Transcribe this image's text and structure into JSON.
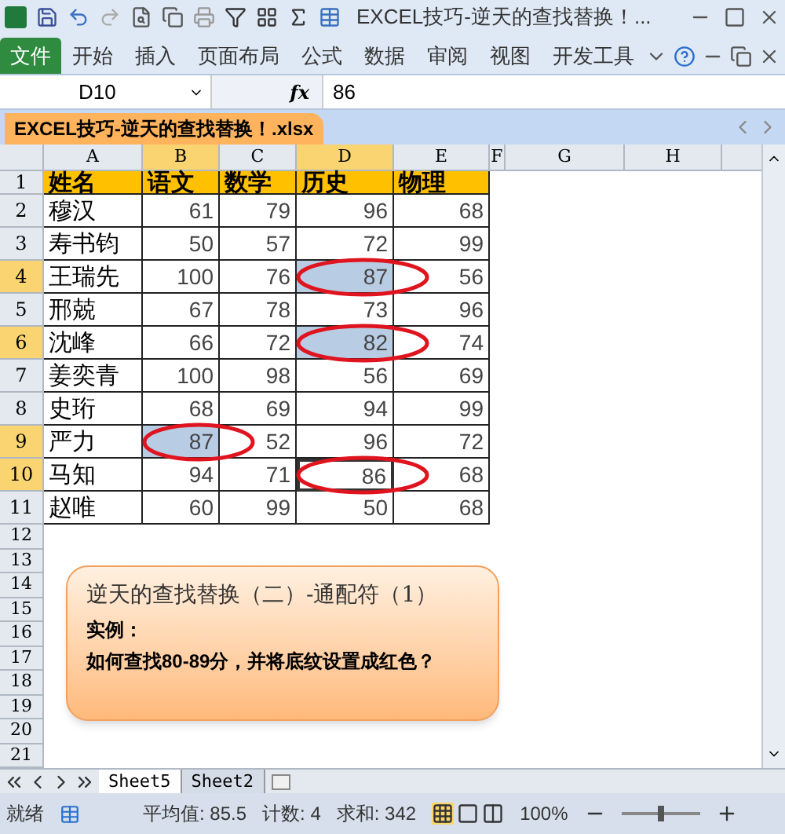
{
  "window": {
    "title": "EXCEL技巧-逆天的查找替换！..."
  },
  "ribbon_tabs": [
    {
      "label": "文件",
      "kind": "file"
    },
    {
      "label": "开始",
      "kind": "tab"
    },
    {
      "label": "插入",
      "kind": "tab"
    },
    {
      "label": "页面布局",
      "kind": "tab"
    },
    {
      "label": "公式",
      "kind": "tab"
    },
    {
      "label": "数据",
      "kind": "tab"
    },
    {
      "label": "审阅",
      "kind": "tab"
    },
    {
      "label": "视图",
      "kind": "tab"
    },
    {
      "label": "开发工具",
      "kind": "tab"
    }
  ],
  "formula_bar": {
    "name_box": "D10",
    "fx": "fx",
    "value": "86"
  },
  "document_tab": {
    "title": "EXCEL技巧-逆天的查找替换！.xlsx"
  },
  "columns": [
    {
      "label": "A",
      "selected": false
    },
    {
      "label": "B",
      "selected": true
    },
    {
      "label": "C",
      "selected": false
    },
    {
      "label": "D",
      "selected": true
    },
    {
      "label": "E",
      "selected": false
    },
    {
      "label": "F",
      "selected": false
    },
    {
      "label": "G",
      "selected": false
    },
    {
      "label": "H",
      "selected": false
    }
  ],
  "rows": [
    {
      "number": "1",
      "selected": false,
      "header": true,
      "cells": [
        {
          "value": "姓名",
          "selected": false,
          "active": false,
          "circled": false
        },
        {
          "value": "语文",
          "selected": false,
          "active": false,
          "circled": false
        },
        {
          "value": "数学",
          "selected": false,
          "active": false,
          "circled": false
        },
        {
          "value": "历史",
          "selected": false,
          "active": false,
          "circled": false
        },
        {
          "value": "物理",
          "selected": false,
          "active": false,
          "circled": false
        }
      ]
    },
    {
      "number": "2",
      "selected": false,
      "header": false,
      "cells": [
        {
          "value": "穆汉",
          "selected": false,
          "active": false,
          "circled": false
        },
        {
          "value": "61",
          "selected": false,
          "active": false,
          "circled": false
        },
        {
          "value": "79",
          "selected": false,
          "active": false,
          "circled": false
        },
        {
          "value": "96",
          "selected": false,
          "active": false,
          "circled": false
        },
        {
          "value": "68",
          "selected": false,
          "active": false,
          "circled": false
        }
      ]
    },
    {
      "number": "3",
      "selected": false,
      "header": false,
      "cells": [
        {
          "value": "寿书钧",
          "selected": false,
          "active": false,
          "circled": false
        },
        {
          "value": "50",
          "selected": false,
          "active": false,
          "circled": false
        },
        {
          "value": "57",
          "selected": false,
          "active": false,
          "circled": false
        },
        {
          "value": "72",
          "selected": false,
          "active": false,
          "circled": false
        },
        {
          "value": "99",
          "selected": false,
          "active": false,
          "circled": false
        }
      ]
    },
    {
      "number": "4",
      "selected": true,
      "header": false,
      "cells": [
        {
          "value": "王瑞先",
          "selected": false,
          "active": false,
          "circled": false
        },
        {
          "value": "100",
          "selected": false,
          "active": false,
          "circled": false
        },
        {
          "value": "76",
          "selected": false,
          "active": false,
          "circled": false
        },
        {
          "value": "87",
          "selected": true,
          "active": false,
          "circled": true
        },
        {
          "value": "56",
          "selected": false,
          "active": false,
          "circled": false
        }
      ]
    },
    {
      "number": "5",
      "selected": false,
      "header": false,
      "cells": [
        {
          "value": "邢兢",
          "selected": false,
          "active": false,
          "circled": false
        },
        {
          "value": "67",
          "selected": false,
          "active": false,
          "circled": false
        },
        {
          "value": "78",
          "selected": false,
          "active": false,
          "circled": false
        },
        {
          "value": "73",
          "selected": false,
          "active": false,
          "circled": false
        },
        {
          "value": "96",
          "selected": false,
          "active": false,
          "circled": false
        }
      ]
    },
    {
      "number": "6",
      "selected": true,
      "header": false,
      "cells": [
        {
          "value": "沈峰",
          "selected": false,
          "active": false,
          "circled": false
        },
        {
          "value": "66",
          "selected": false,
          "active": false,
          "circled": false
        },
        {
          "value": "72",
          "selected": false,
          "active": false,
          "circled": false
        },
        {
          "value": "82",
          "selected": true,
          "active": false,
          "circled": true
        },
        {
          "value": "74",
          "selected": false,
          "active": false,
          "circled": false
        }
      ]
    },
    {
      "number": "7",
      "selected": false,
      "header": false,
      "cells": [
        {
          "value": "姜奕青",
          "selected": false,
          "active": false,
          "circled": false
        },
        {
          "value": "100",
          "selected": false,
          "active": false,
          "circled": false
        },
        {
          "value": "98",
          "selected": false,
          "active": false,
          "circled": false
        },
        {
          "value": "56",
          "selected": false,
          "active": false,
          "circled": false
        },
        {
          "value": "69",
          "selected": false,
          "active": false,
          "circled": false
        }
      ]
    },
    {
      "number": "8",
      "selected": false,
      "header": false,
      "cells": [
        {
          "value": "史珩",
          "selected": false,
          "active": false,
          "circled": false
        },
        {
          "value": "68",
          "selected": false,
          "active": false,
          "circled": false
        },
        {
          "value": "69",
          "selected": false,
          "active": false,
          "circled": false
        },
        {
          "value": "94",
          "selected": false,
          "active": false,
          "circled": false
        },
        {
          "value": "99",
          "selected": false,
          "active": false,
          "circled": false
        }
      ]
    },
    {
      "number": "9",
      "selected": true,
      "header": false,
      "cells": [
        {
          "value": "严力",
          "selected": false,
          "active": false,
          "circled": false
        },
        {
          "value": "87",
          "selected": true,
          "active": false,
          "circled": true
        },
        {
          "value": "52",
          "selected": false,
          "active": false,
          "circled": false
        },
        {
          "value": "96",
          "selected": false,
          "active": false,
          "circled": false
        },
        {
          "value": "72",
          "selected": false,
          "active": false,
          "circled": false
        }
      ]
    },
    {
      "number": "10",
      "selected": true,
      "header": false,
      "cells": [
        {
          "value": "马知",
          "selected": false,
          "active": false,
          "circled": false
        },
        {
          "value": "94",
          "selected": false,
          "active": false,
          "circled": false
        },
        {
          "value": "71",
          "selected": false,
          "active": false,
          "circled": false
        },
        {
          "value": "86",
          "selected": false,
          "active": true,
          "circled": true
        },
        {
          "value": "68",
          "selected": false,
          "active": false,
          "circled": false
        }
      ]
    },
    {
      "number": "11",
      "selected": false,
      "header": false,
      "cells": [
        {
          "value": "赵唯",
          "selected": false,
          "active": false,
          "circled": false
        },
        {
          "value": "60",
          "selected": false,
          "active": false,
          "circled": false
        },
        {
          "value": "99",
          "selected": false,
          "active": false,
          "circled": false
        },
        {
          "value": "50",
          "selected": false,
          "active": false,
          "circled": false
        },
        {
          "value": "68",
          "selected": false,
          "active": false,
          "circled": false
        }
      ]
    }
  ],
  "empty_rows": [
    "12",
    "13",
    "14",
    "15",
    "16",
    "17",
    "18",
    "19",
    "20",
    "21"
  ],
  "callout": {
    "title": "逆天的查找替换（二）-通配符（1）",
    "label": "实例：",
    "question": "如何查找80-89分，并将底纹设置成红色？"
  },
  "sheet_tabs": [
    {
      "label": "Sheet5",
      "selected": true
    },
    {
      "label": "Sheet2",
      "selected": false
    }
  ],
  "status_bar": {
    "state": "就绪",
    "average": "平均值: 85.5",
    "count": "计数: 4",
    "sum": "求和: 342",
    "zoom": "100%",
    "zoom_level": {
      "level": 0.5
    }
  }
}
